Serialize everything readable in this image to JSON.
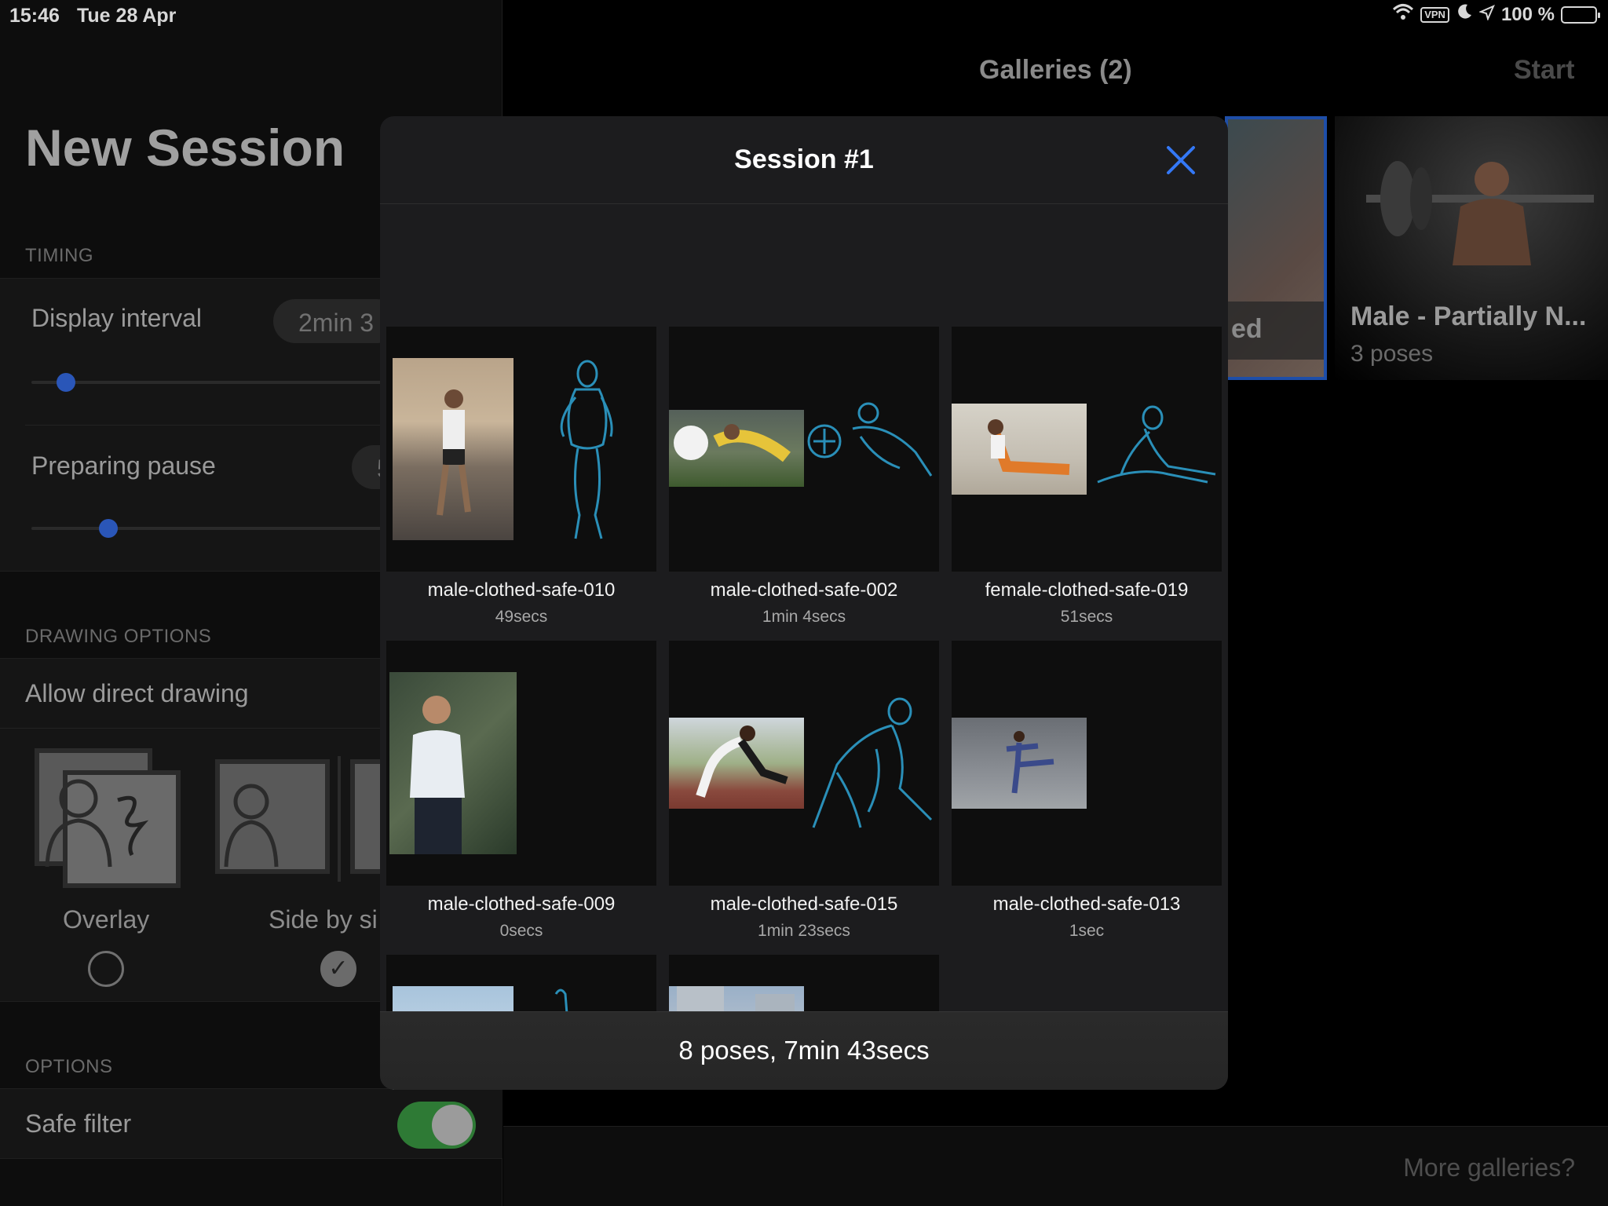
{
  "status_bar": {
    "time": "15:46",
    "date": "Tue 28 Apr",
    "vpn": "VPN",
    "battery": "100 %"
  },
  "left_panel": {
    "title": "New Session",
    "timing_label": "TIMING",
    "display_interval_label": "Display interval",
    "display_interval_value": "2min 3",
    "preparing_pause_label": "Preparing pause",
    "preparing_pause_value": "5",
    "drawing_options_label": "DRAWING OPTIONS",
    "allow_direct_drawing_label": "Allow direct drawing",
    "overlay_label": "Overlay",
    "side_by_side_label": "Side by si",
    "options_label": "OPTIONS",
    "safe_filter_label": "Safe filter"
  },
  "right_panel": {
    "title": "Galleries (2)",
    "start_label": "Start",
    "selected_gallery_partial_label": "ed",
    "gallery_2_title": "Male - Partially N...",
    "gallery_2_subtitle": "3 poses",
    "more_galleries_label": "More galleries?"
  },
  "modal": {
    "title": "Session #1",
    "footer": "8 poses, 7min 43secs",
    "poses": [
      {
        "name": "male-clothed-safe-010",
        "time": "49secs"
      },
      {
        "name": "male-clothed-safe-002",
        "time": "1min 4secs"
      },
      {
        "name": "female-clothed-safe-019",
        "time": "51secs"
      },
      {
        "name": "male-clothed-safe-009",
        "time": "0secs"
      },
      {
        "name": "male-clothed-safe-015",
        "time": "1min 23secs"
      },
      {
        "name": "male-clothed-safe-013",
        "time": "1sec"
      },
      {
        "name": "",
        "time": ""
      },
      {
        "name": "",
        "time": ""
      }
    ]
  },
  "colors": {
    "accent": "#3478f6",
    "sketch": "#2a8fb8",
    "toggle_on": "#2e7a35"
  }
}
